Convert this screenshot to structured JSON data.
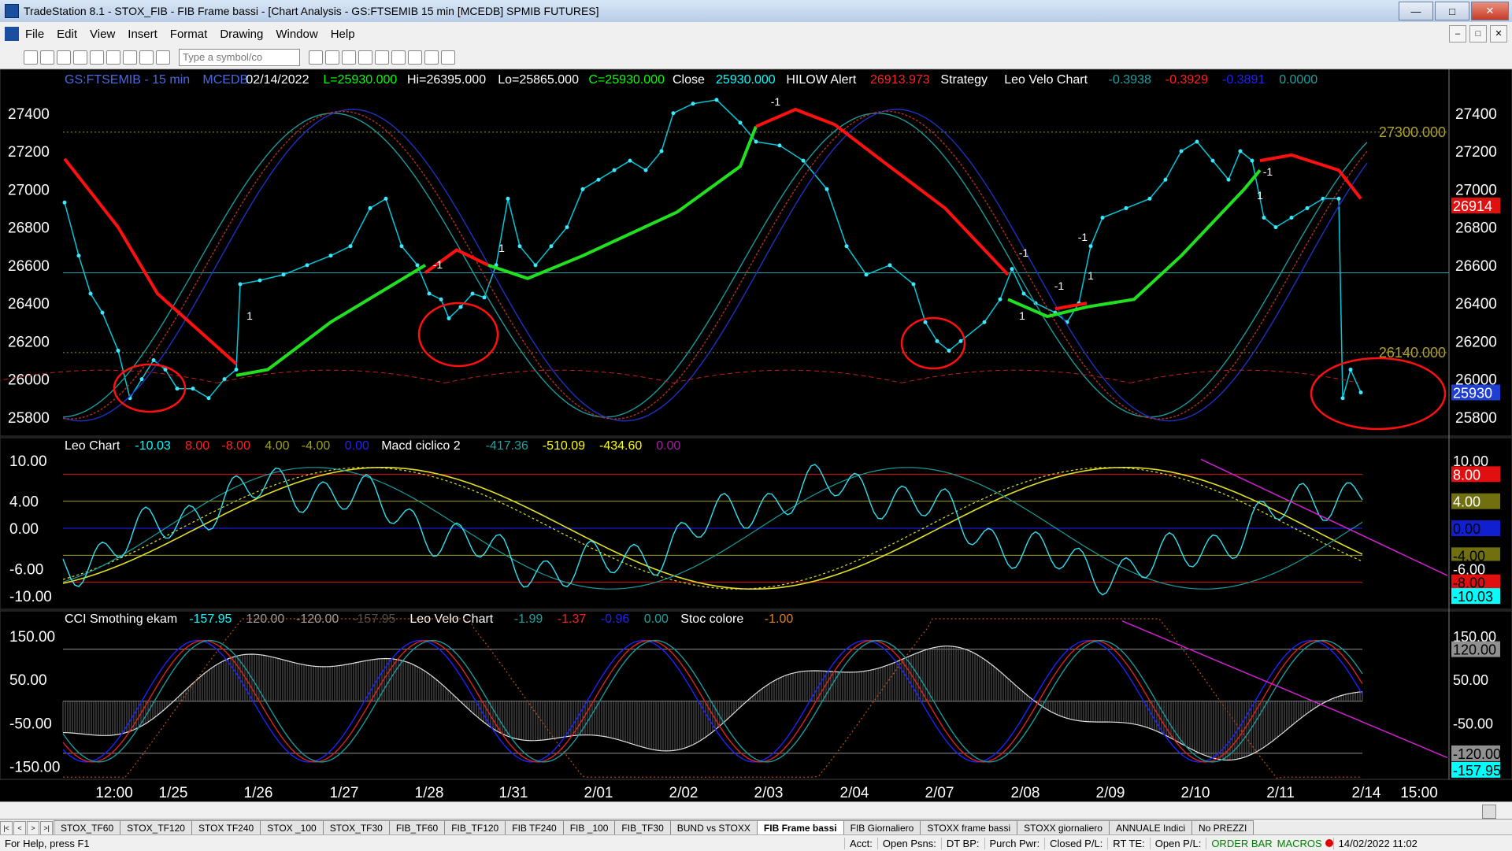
{
  "window": {
    "title": "TradeStation 8.1 - STOX_FIB - FIB Frame bassi - [Chart Analysis - GS:FTSEMIB 15 min [MCEDB] SPMIB FUTURES]"
  },
  "menu": [
    "File",
    "Edit",
    "View",
    "Insert",
    "Format",
    "Drawing",
    "Window",
    "Help"
  ],
  "toolbar": {
    "symbol_placeholder": "Type a symbol/co"
  },
  "panel1": {
    "header": [
      {
        "t": "GS:FTSEMIB - 15 min",
        "c": "#4a6adf"
      },
      {
        "t": "MCEDB",
        "c": "#4a6adf"
      },
      {
        "t": "02/14/2022",
        "c": "#ffffff"
      },
      {
        "t": "L=25930.000",
        "c": "#00ff00"
      },
      {
        "t": "Hi=26395.000",
        "c": "#ffffff"
      },
      {
        "t": "Lo=25865.000",
        "c": "#ffffff"
      },
      {
        "t": "C=25930.000",
        "c": "#00ff00"
      },
      {
        "t": "Close",
        "c": "#ffffff"
      },
      {
        "t": "25930.000",
        "c": "#00ffff"
      },
      {
        "t": "HILOW Alert",
        "c": "#ffffff"
      },
      {
        "t": "26913.973",
        "c": "#ff2020"
      },
      {
        "t": "Strategy",
        "c": "#ffffff"
      },
      {
        "t": "Leo Velo Chart",
        "c": "#ffffff"
      },
      {
        "t": "-0.3938",
        "c": "#20a0a0"
      },
      {
        "t": "-0.3929",
        "c": "#ff2020"
      },
      {
        "t": "-0.3891",
        "c": "#2020ff"
      },
      {
        "t": "0.0000",
        "c": "#20a0a0"
      }
    ],
    "yticks": [
      "27400",
      "27200",
      "27000",
      "26800",
      "26600",
      "26400",
      "26200",
      "26000",
      "25800"
    ],
    "right_labels": [
      {
        "t": "26914",
        "bg": "#e01010",
        "fg": "#ffffff"
      },
      {
        "t": "25930",
        "bg": "#1e3fd0",
        "fg": "#ffffff"
      }
    ],
    "levels": [
      {
        "t": "27300.000"
      },
      {
        "t": "26140.000"
      }
    ],
    "markers": [
      "-1",
      "1",
      "-1",
      "1",
      "-1",
      "1",
      "-1",
      "1",
      "-1",
      "1",
      "-1"
    ]
  },
  "panel2": {
    "header": [
      {
        "t": "Leo Chart",
        "c": "#ffffff"
      },
      {
        "t": "-10.03",
        "c": "#00ffff"
      },
      {
        "t": "8.00",
        "c": "#ff2020"
      },
      {
        "t": "-8.00",
        "c": "#ff2020"
      },
      {
        "t": "4.00",
        "c": "#a0a020"
      },
      {
        "t": "-4.00",
        "c": "#a0a020"
      },
      {
        "t": "0.00",
        "c": "#2020ff"
      },
      {
        "t": "Macd ciclico 2",
        "c": "#ffffff"
      },
      {
        "t": "-417.36",
        "c": "#20a0a0"
      },
      {
        "t": "-510.09",
        "c": "#ffff00"
      },
      {
        "t": "-434.60",
        "c": "#ffff00"
      },
      {
        "t": "0.00",
        "c": "#a020a0"
      }
    ],
    "yticks": [
      "10.00",
      "4.00",
      "0.00",
      "-6.00",
      "-10.00"
    ],
    "right_labels": [
      {
        "t": "10.00",
        "bg": "#000000",
        "fg": "#ffffff"
      },
      {
        "t": "8.00",
        "bg": "#e01010",
        "fg": "#ffffff"
      },
      {
        "t": "4.00",
        "bg": "#707010",
        "fg": "#ffffff"
      },
      {
        "t": "0.00",
        "bg": "#1020d0",
        "fg": "#000000"
      },
      {
        "t": "-4.00",
        "bg": "#707010",
        "fg": "#000000"
      },
      {
        "t": "-6.00",
        "bg": "#000000",
        "fg": "#ffffff"
      },
      {
        "t": "-8.00",
        "bg": "#e01010",
        "fg": "#000000"
      },
      {
        "t": "-10.03",
        "bg": "#00ffff",
        "fg": "#000000"
      }
    ]
  },
  "panel3": {
    "header": [
      {
        "t": "CCI Smothing ekam",
        "c": "#ffffff"
      },
      {
        "t": "-157.95",
        "c": "#00ffff"
      },
      {
        "t": "120.00",
        "c": "#a0a0a0"
      },
      {
        "t": "-120.00",
        "c": "#a0a0a0"
      },
      {
        "t": "-157.95",
        "c": "#505050"
      },
      {
        "t": "Leo Velo Chart",
        "c": "#ffffff"
      },
      {
        "t": "-1.99",
        "c": "#20a0a0"
      },
      {
        "t": "-1.37",
        "c": "#ff2020"
      },
      {
        "t": "-0.96",
        "c": "#2020ff"
      },
      {
        "t": "0.00",
        "c": "#20a0a0"
      },
      {
        "t": "Stoc colore",
        "c": "#ffffff"
      },
      {
        "t": "-1.00",
        "c": "#e08020"
      }
    ],
    "yticks": [
      "150.00",
      "50.00",
      "-50.00",
      "-150.00"
    ],
    "right_labels": [
      {
        "t": "150.00",
        "bg": "#000000",
        "fg": "#ffffff"
      },
      {
        "t": "120.00",
        "bg": "#909090",
        "fg": "#000000"
      },
      {
        "t": "50.00",
        "bg": "#000000",
        "fg": "#ffffff"
      },
      {
        "t": "-50.00",
        "bg": "#000000",
        "fg": "#ffffff"
      },
      {
        "t": "-120.00",
        "bg": "#909090",
        "fg": "#000000"
      },
      {
        "t": "-157.95",
        "bg": "#00ffff",
        "fg": "#000000"
      }
    ]
  },
  "xaxis": [
    "12:00",
    "1/25",
    "1/26",
    "1/27",
    "1/28",
    "1/31",
    "2/01",
    "2/02",
    "2/03",
    "2/04",
    "2/07",
    "2/08",
    "2/09",
    "2/10",
    "2/11",
    "2/14",
    "15:00"
  ],
  "tabs": [
    "STOX_TF60",
    "STOX_TF120",
    "STOX TF240",
    "STOX _100",
    "STOX_TF30",
    "FIB_TF60",
    "FIB_TF120",
    "FIB TF240",
    "FIB _100",
    "FIB_TF30",
    "BUND vs STOXX",
    "FIB Frame bassi",
    "FIB Giornaliero",
    "STOXX frame bassi",
    "STOXX giornaliero",
    "ANNUALE Indici",
    "No PREZZI"
  ],
  "active_tab": "FIB Frame bassi",
  "status": {
    "help": "For Help, press F1",
    "items": [
      "Acct:",
      "Open Psns:",
      "DT BP:",
      "Purch Pwr:",
      "Closed P/L:",
      "RT TE:",
      "Open P/L:"
    ],
    "orderbar": "ORDER BAR",
    "macros": "MACROS",
    "datetime": "14/02/2022 11:02"
  }
}
